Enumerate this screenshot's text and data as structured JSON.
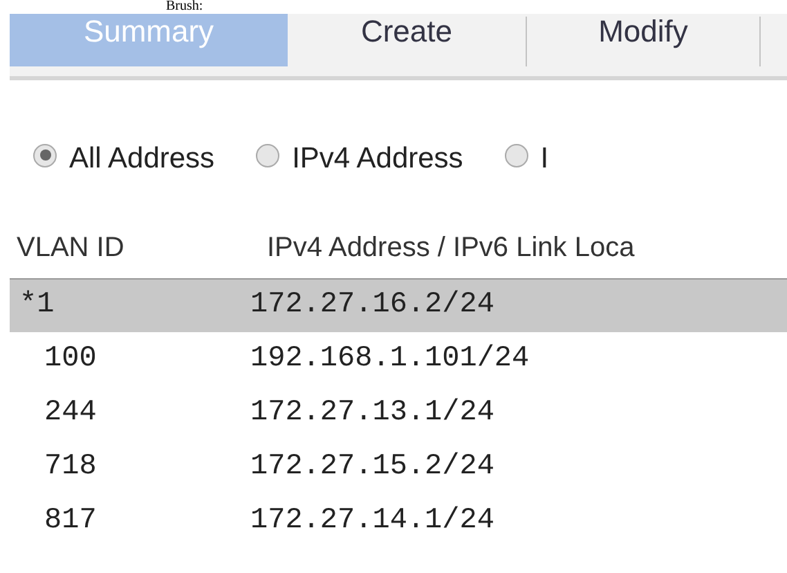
{
  "caption": "Brush:",
  "tabs": [
    {
      "label": "Summary",
      "selected": true
    },
    {
      "label": "Create",
      "selected": false
    },
    {
      "label": "Modify",
      "selected": false
    }
  ],
  "filters": [
    {
      "label": "All Address",
      "selected": true
    },
    {
      "label": "IPv4 Address",
      "selected": false
    },
    {
      "label": "I",
      "selected": false
    }
  ],
  "table": {
    "columns": [
      "VLAN ID",
      "IPv4 Address / IPv6 Link Loca"
    ],
    "rows": [
      {
        "cells": [
          "*1",
          "172.27.16.2/24"
        ],
        "selected": true
      },
      {
        "cells": [
          "100",
          "192.168.1.101/24"
        ],
        "selected": false
      },
      {
        "cells": [
          "244",
          "172.27.13.1/24"
        ],
        "selected": false
      },
      {
        "cells": [
          "718",
          "172.27.15.2/24"
        ],
        "selected": false
      },
      {
        "cells": [
          "817",
          "172.27.14.1/24"
        ],
        "selected": false
      }
    ]
  }
}
